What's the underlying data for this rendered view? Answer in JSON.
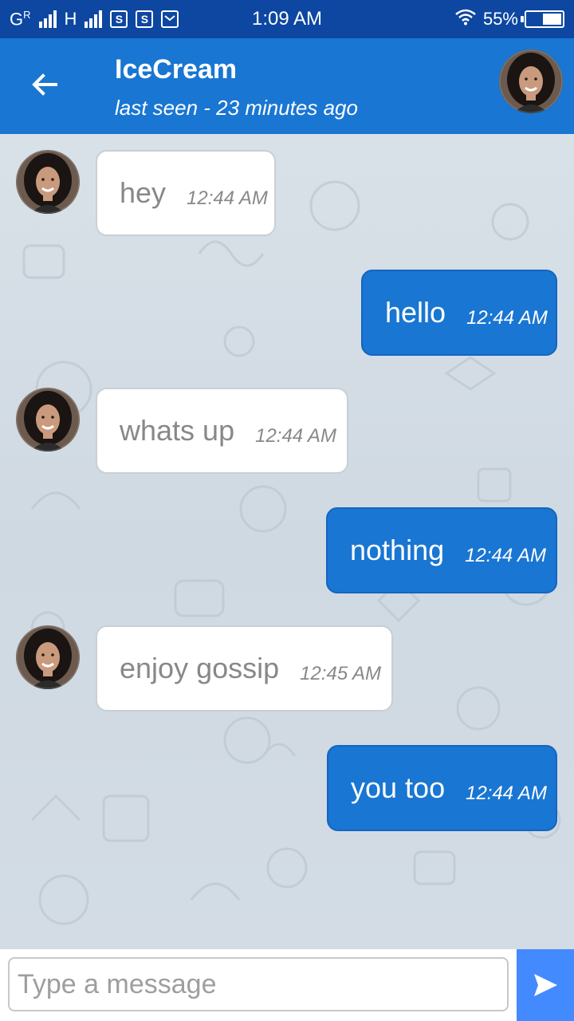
{
  "status_bar": {
    "network_left": "G",
    "network_left_sup": "R",
    "network_right": "H",
    "sim_badge_1": "S",
    "sim_badge_2": "S",
    "time": "1:09 AM",
    "battery_percent": "55%",
    "battery_level": 0.55
  },
  "header": {
    "contact_name": "IceCream",
    "last_seen": "last seen - 23 minutes ago",
    "back_icon": "arrow-left-icon",
    "avatar_icon": "contact-avatar"
  },
  "messages": [
    {
      "direction": "incoming",
      "text": "hey",
      "time": "12:44 AM"
    },
    {
      "direction": "outgoing",
      "text": "hello",
      "time": "12:44 AM"
    },
    {
      "direction": "incoming",
      "text": "whats up",
      "time": "12:44 AM"
    },
    {
      "direction": "outgoing",
      "text": "nothing",
      "time": "12:44 AM"
    },
    {
      "direction": "incoming",
      "text": "enjoy gossip",
      "time": "12:45 AM"
    },
    {
      "direction": "outgoing",
      "text": "you too",
      "time": "12:44 AM"
    }
  ],
  "composer": {
    "placeholder": "Type a message",
    "value": "",
    "send_icon": "send-icon"
  },
  "colors": {
    "status_bar": "#0d47a1",
    "app_bar": "#1976d2",
    "outgoing_bubble": "#1976d2",
    "incoming_bubble": "#ffffff",
    "send_button": "#448aff",
    "chat_background": "#d6dee5"
  }
}
